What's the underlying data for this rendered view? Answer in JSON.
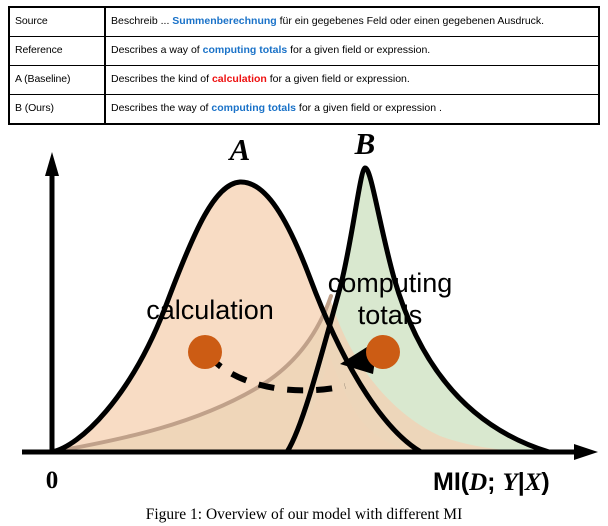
{
  "table": {
    "rows": [
      {
        "label": "Source",
        "segments": [
          {
            "text": "Beschreib ... ",
            "style": "plain"
          },
          {
            "text": "Summenberechnung",
            "style": "blue"
          },
          {
            "text": " für ein gegebenes Feld oder einen gegebenen Ausdruck.",
            "style": "plain"
          }
        ]
      },
      {
        "label": "Reference",
        "segments": [
          {
            "text": "Describes a way of ",
            "style": "plain"
          },
          {
            "text": "computing totals",
            "style": "blue"
          },
          {
            "text": " for a given field or expression.",
            "style": "plain"
          }
        ]
      },
      {
        "label": "A (Baseline)",
        "segments": [
          {
            "text": "Describes the kind of ",
            "style": "plain"
          },
          {
            "text": "calculation",
            "style": "red"
          },
          {
            "text": " for a given field or expression.",
            "style": "plain"
          }
        ]
      },
      {
        "label": "B (Ours)",
        "segments": [
          {
            "text": "Describes the way of ",
            "style": "plain"
          },
          {
            "text": "computing totals",
            "style": "blue"
          },
          {
            "text": " for a given field or expression .",
            "style": "plain"
          }
        ]
      }
    ]
  },
  "chart_data": {
    "type": "area",
    "title": "",
    "xlabel": "MI(D; Y|X)",
    "ylabel": "",
    "xlim": [
      0,
      1
    ],
    "ylim": [
      0,
      1
    ],
    "grid": false,
    "legend": "none",
    "axis_origin_label": "0",
    "series": [
      {
        "name": "A",
        "peak_label": "A",
        "region_label": "calculation",
        "fill": "#f8dcc4",
        "stroke": "#000000",
        "peak_x": 0.38,
        "peak_y": 0.95,
        "start_x": 0.0,
        "end_x": 1.0
      },
      {
        "name": "B",
        "peak_label": "B",
        "region_label": "computing totals",
        "fill": "#d9e8cf",
        "stroke": "#000000",
        "peak_x": 0.63,
        "peak_y": 1.0,
        "start_x": 0.18,
        "end_x": 1.0
      }
    ],
    "overlap_fill": "#eed5b8",
    "secondary_curve": {
      "name": "inner-boundary",
      "stroke": "#c0a18a"
    },
    "markers": [
      {
        "name": "source-point",
        "label": "",
        "x": 0.335,
        "y": 0.27,
        "color": "#cc5c14"
      },
      {
        "name": "target-point",
        "label": "",
        "x": 0.63,
        "y": 0.27,
        "color": "#cc5c14"
      }
    ],
    "annotation_arrow": {
      "name": "shift-arrow",
      "style": "dashed",
      "from": [
        0.335,
        0.27
      ],
      "to": [
        0.63,
        0.27
      ],
      "color": "#000000"
    },
    "colors": {
      "peach": "#f8dcc4",
      "green": "#d9e8cf",
      "overlap": "#eed5b8",
      "orange": "#cc5c14",
      "tan_line": "#c0a18a",
      "axis": "#000000"
    }
  },
  "labels": {
    "peak_a": "A",
    "peak_b": "B",
    "region_a": "calculation",
    "region_b_line1": "computing",
    "region_b_line2": "totals",
    "origin": "0",
    "x_axis": {
      "prefix": "MI(",
      "var1": "D",
      "sep": "; ",
      "var2": "Y",
      "bar": "|",
      "var3": "X",
      "suffix": ")"
    }
  },
  "caption": {
    "text": "Figure 1: Overview of our model with different MI"
  }
}
